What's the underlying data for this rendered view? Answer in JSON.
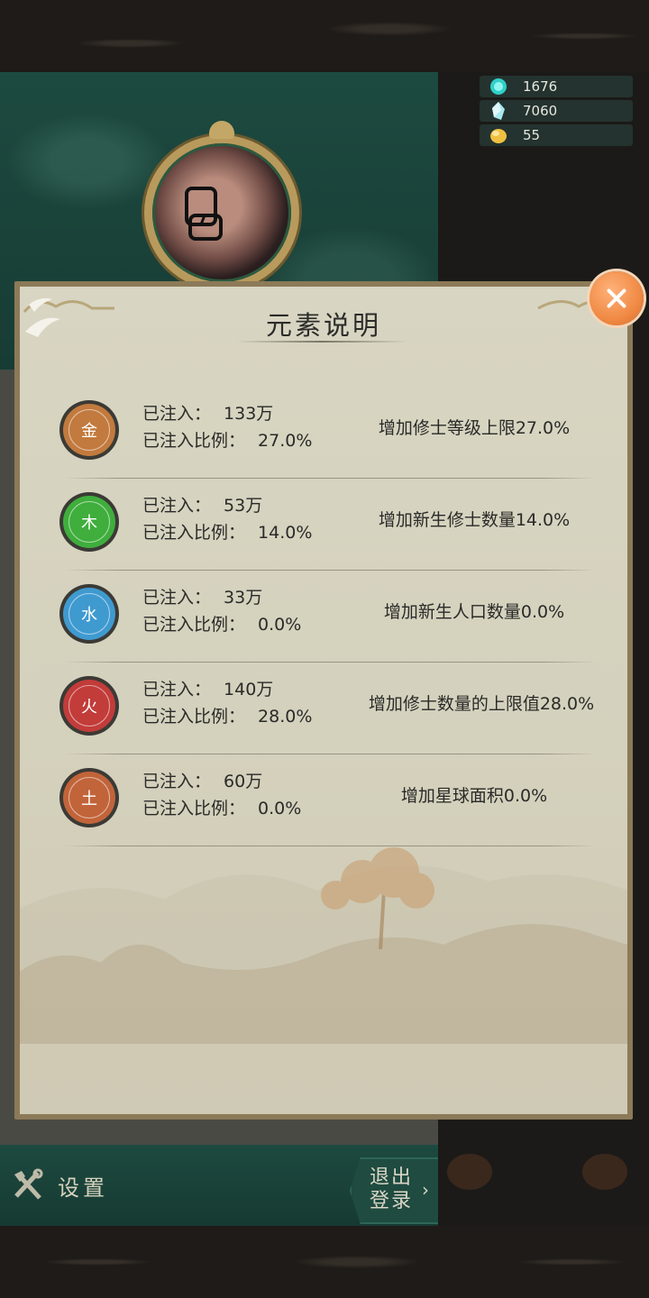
{
  "currency": [
    {
      "icon": "spirit-orb-icon",
      "value": "1676",
      "color": "#2fd0c8"
    },
    {
      "icon": "crystal-icon",
      "value": "7060",
      "color": "#a8e8f0"
    },
    {
      "icon": "gold-nugget-icon",
      "value": "55",
      "color": "#f0c040"
    }
  ],
  "dialog": {
    "title": "元素说明",
    "elements": [
      {
        "symbol": "金",
        "color": "#c27a3e",
        "injected_label": "已注入：",
        "injected_value": "133万",
        "ratio_label": "已注入比例：",
        "ratio_value": "27.0%",
        "effect": "增加修士等级上限27.0%"
      },
      {
        "symbol": "木",
        "color": "#3fae3c",
        "injected_label": "已注入：",
        "injected_value": "53万",
        "ratio_label": "已注入比例：",
        "ratio_value": "14.0%",
        "effect": "增加新生修士数量14.0%"
      },
      {
        "symbol": "水",
        "color": "#3f9ad0",
        "injected_label": "已注入：",
        "injected_value": "33万",
        "ratio_label": "已注入比例：",
        "ratio_value": "0.0%",
        "effect": "增加新生人口数量0.0%"
      },
      {
        "symbol": "火",
        "color": "#c23c3a",
        "injected_label": "已注入：",
        "injected_value": "140万",
        "ratio_label": "已注入比例：",
        "ratio_value": "28.0%",
        "effect": "增加修士数量的上限值28.0%"
      },
      {
        "symbol": "土",
        "color": "#c2643a",
        "injected_label": "已注入：",
        "injected_value": "60万",
        "ratio_label": "已注入比例：",
        "ratio_value": "0.0%",
        "effect": "增加星球面积0.0%"
      }
    ]
  },
  "bottom": {
    "settings_label": "设置",
    "logout_label": "退出登录"
  }
}
